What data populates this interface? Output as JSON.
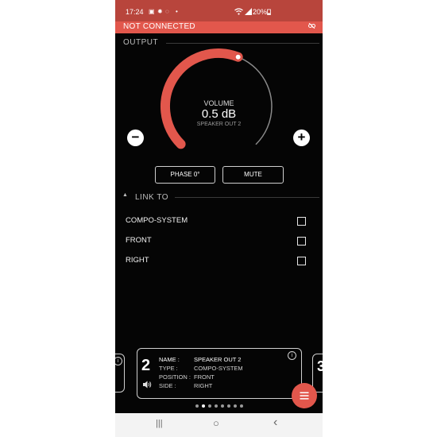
{
  "status_bar": {
    "time": "17:24",
    "left_icons": [
      "image-icon",
      "settings-icon",
      "sync-icon",
      "dot-icon"
    ],
    "right_icons": [
      "wifi-icon",
      "signal-icon"
    ],
    "battery": "20%"
  },
  "connection": {
    "label": "NOT CONNECTED",
    "icon": "link-off-icon",
    "bar_color": "#e2574c"
  },
  "output": {
    "section_title": "OUTPUT",
    "volume_label": "VOLUME",
    "volume_value": "0.5 dB",
    "channel_name": "SPEAKER OUT 2",
    "volume_level_fraction": 0.58,
    "minus_label": "−",
    "plus_label": "+",
    "phase_button": "PHASE 0°",
    "mute_button": "MUTE",
    "accent_color": "#e2574c"
  },
  "link_to": {
    "section_title": "LINK TO",
    "items": [
      {
        "label": "COMPO-SYSTEM",
        "checked": false
      },
      {
        "label": "FRONT",
        "checked": false
      },
      {
        "label": "RIGHT",
        "checked": false
      }
    ]
  },
  "card": {
    "number": "2",
    "name_key": "NAME :",
    "name_val": "SPEAKER OUT 2",
    "type_key": "TYPE :",
    "type_val": "COMPO-SYSTEM",
    "position_key": "POSITION :",
    "position_val": "FRONT",
    "side_key": "SIDE :",
    "side_val": "RIGHT",
    "next_number": "3"
  },
  "pagination": {
    "total": 8,
    "active": 1
  },
  "navbar": {
    "recent_icon": "|||",
    "home_icon": "○",
    "back_icon": "‹"
  }
}
